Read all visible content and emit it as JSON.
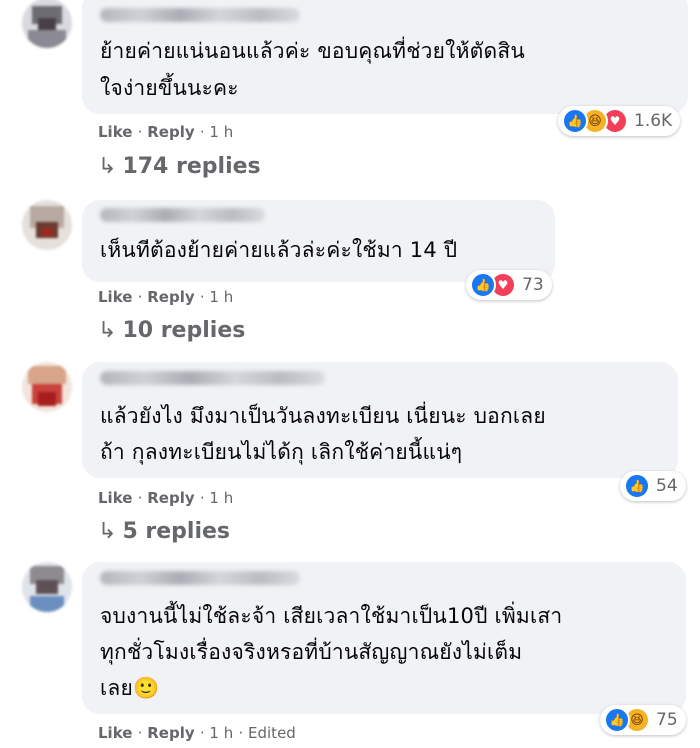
{
  "comments": [
    {
      "text_lines": [
        "ย้ายค่ายแน่นอนแล้วค่ะ ขอบคุณที่ช่วยให้ตัดสิน",
        "ใจง่ายขึ้นนะคะ"
      ],
      "reaction_icons": [
        "like-icon",
        "haha-icon",
        "love-icon"
      ],
      "reaction_count": "1.6K",
      "like_label": "Like",
      "reply_label": "Reply",
      "time": "1 h",
      "replies_label": "174 replies"
    },
    {
      "text_lines": [
        "เห็นทีต้องย้ายค่ายแล้วล่ะค่ะใช้มา 14 ปี"
      ],
      "reaction_icons": [
        "like-icon",
        "love-icon"
      ],
      "reaction_count": "73",
      "like_label": "Like",
      "reply_label": "Reply",
      "time": "1 h",
      "replies_label": "10 replies"
    },
    {
      "text_lines": [
        "แล้วยังไง มึงมาเป็นวันลงทะเบียน เนี่ยนะ บอกเลย",
        "ถ้า กุลงทะเบียนไม่ได้กุ เลิกใช้ค่ายนี้แน่ๆ"
      ],
      "reaction_icons": [
        "like-icon"
      ],
      "reaction_count": "54",
      "like_label": "Like",
      "reply_label": "Reply",
      "time": "1 h",
      "replies_label": "5 replies"
    },
    {
      "text_lines": [
        "จบงานนี้ไม่ใช้ละจ้า เสียเวลาใช้มาเป็น10ปี เพิ่มเสา",
        "ทุกชั่วโมงเรื่องจริงหรอที่บ้านสัญญาณยังไม่เต็ม",
        "เลย🙂"
      ],
      "reaction_icons": [
        "like-icon",
        "haha-icon"
      ],
      "reaction_count": "75",
      "like_label": "Like",
      "reply_label": "Reply",
      "time": "1 h",
      "edited_label": "Edited"
    }
  ],
  "colors": {
    "bubble": "#f0f2f5",
    "meta_text": "#65676b",
    "like_blue": "#1877f2",
    "love_red": "#f33e58",
    "haha_yellow": "#f7b125"
  }
}
